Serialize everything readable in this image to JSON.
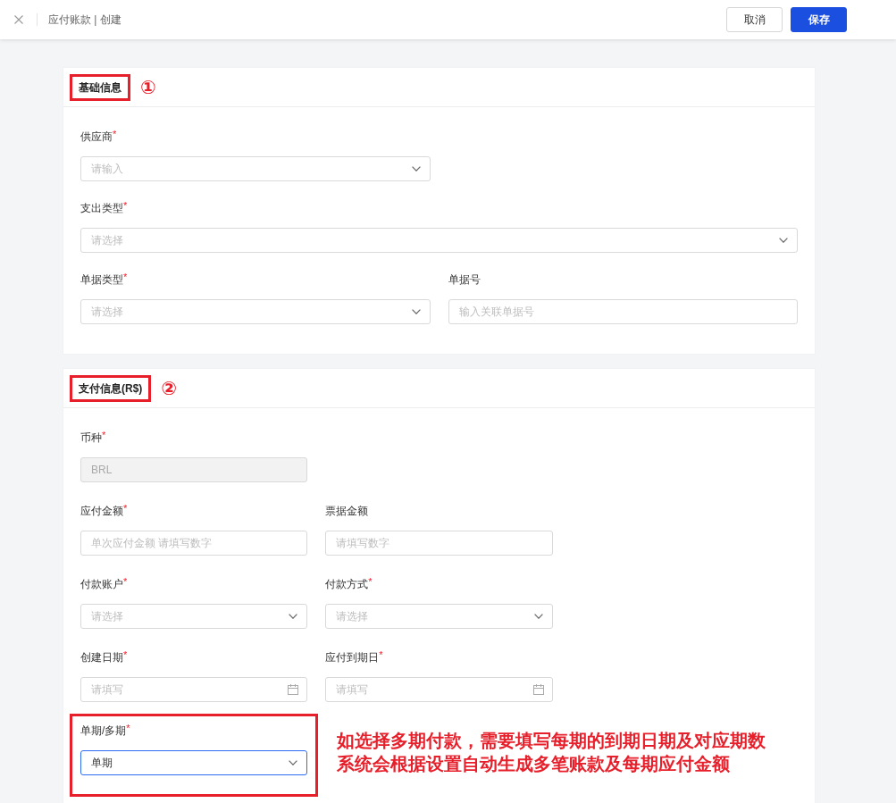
{
  "header": {
    "title": "应付账款 | 创建",
    "buttons": [
      {
        "label": "取消",
        "kind": "secondary"
      },
      {
        "label": "保存",
        "kind": "primary"
      }
    ]
  },
  "sections": [
    {
      "title": "基础信息",
      "marker": "①",
      "highlighted": true,
      "kind": "wide",
      "rows": [
        {
          "fields": [
            {
              "label": "供应商$^{*}$",
              "kind": "select",
              "placeholder": "请输入",
              "full_width": false,
              "disabled": false,
              "focused": false,
              "highlighted": false
            }
          ]
        },
        {
          "fields": [
            {
              "label": "支出类型$^{*}$",
              "kind": "select",
              "placeholder": "请选择",
              "full_width": true,
              "disabled": false,
              "focused": false,
              "highlighted": false
            }
          ]
        },
        {
          "fields": [
            {
              "label": "单据类型$^{*}$",
              "kind": "select",
              "placeholder": "请选择",
              "full_width": false,
              "disabled": false,
              "focused": false,
              "highlighted": false
            },
            {
              "label": "单据号",
              "kind": "text",
              "placeholder": "输入关联单据号",
              "full_width": false,
              "disabled": false,
              "focused": false,
              "highlighted": false
            }
          ]
        }
      ]
    },
    {
      "title": "支付信息(R$)",
      "marker": "②",
      "highlighted": true,
      "kind": "narrow",
      "rows": [
        {
          "fields": [
            {
              "label": "币种$^{*}$",
              "kind": "text",
              "value": "BRL",
              "full_width": false,
              "disabled": true,
              "focused": false,
              "highlighted": false
            }
          ]
        },
        {
          "fields": [
            {
              "label": "应付金额$^{*}$",
              "kind": "text",
              "placeholder": "单次应付金额 请填写数字",
              "full_width": false,
              "disabled": false,
              "focused": false,
              "highlighted": false
            },
            {
              "label": "票据金额",
              "kind": "text",
              "placeholder": "请填写数字",
              "full_width": false,
              "disabled": false,
              "focused": false,
              "highlighted": false
            }
          ]
        },
        {
          "fields": [
            {
              "label": "付款账户$^{*}$",
              "kind": "select",
              "placeholder": "请选择",
              "full_width": false,
              "disabled": false,
              "focused": false,
              "highlighted": false
            },
            {
              "label": "付款方式$^{*}$",
              "kind": "select",
              "placeholder": "请选择",
              "full_width": false,
              "disabled": false,
              "focused": false,
              "highlighted": false
            }
          ]
        },
        {
          "fields": [
            {
              "label": "创建日期$^{*}$",
              "kind": "date",
              "placeholder": "请填写",
              "full_width": false,
              "disabled": false,
              "focused": false,
              "highlighted": false
            },
            {
              "label": "应付到期日$^{*}$",
              "kind": "date",
              "placeholder": "请填写",
              "full_width": false,
              "disabled": false,
              "focused": false,
              "highlighted": false
            }
          ]
        },
        {
          "fields": [
            {
              "label": "单期/多期$^{*}$",
              "kind": "select",
              "value": "单期",
              "full_width": false,
              "disabled": false,
              "focused": true,
              "highlighted": true,
              "note": [
                "如选择多期付款，需要填写每期的到期日期及对应期数",
                "系统会根据设置自动生成多笔账款及每期应付金额"
              ]
            }
          ]
        }
      ]
    }
  ]
}
